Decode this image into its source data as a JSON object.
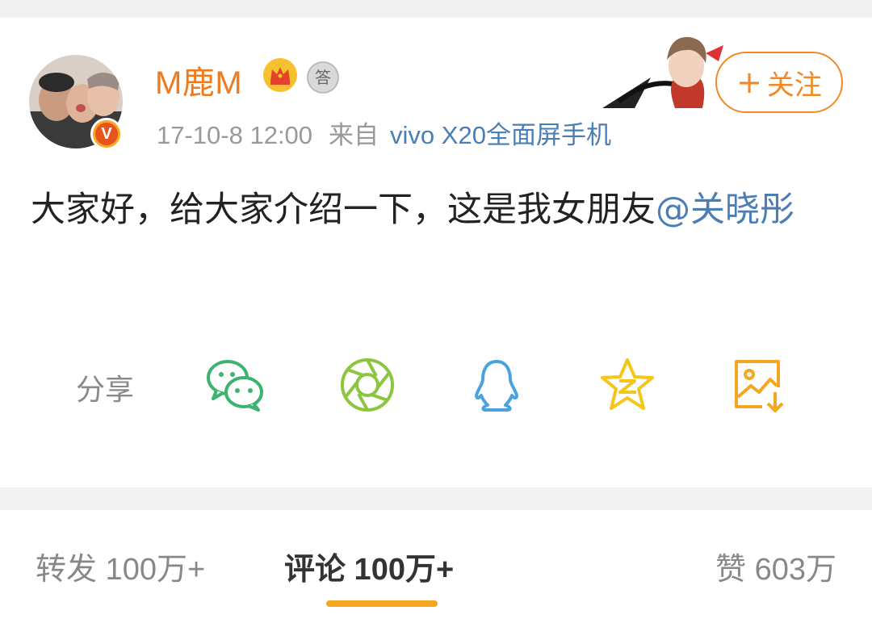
{
  "post": {
    "username": "M鹿M",
    "badge_medal_text": "答",
    "time": "17-10-8 12:00",
    "source_prefix": "来自",
    "device": "vivo X20全面屏手机",
    "text": "大家好，给大家介绍一下，这是我女朋友",
    "mention": "@关晓彤"
  },
  "follow": {
    "plus": "+",
    "label": "关注"
  },
  "share": {
    "label": "分享",
    "icons": [
      "wechat-icon",
      "moments-icon",
      "qq-icon",
      "qzone-icon",
      "save-image-icon"
    ]
  },
  "tabs": {
    "repost": "转发 100万+",
    "comment": "评论 100万+",
    "like": "赞 603万"
  },
  "colors": {
    "username": "#ee7b1f",
    "link": "#4a7eb5",
    "follow": "#f08a24",
    "tab_underline": "#f5a623",
    "wechat": "#3cb371",
    "moments": "#8cc63f",
    "qq": "#4aa3df",
    "qzone": "#f5c518",
    "save": "#f5a623"
  }
}
